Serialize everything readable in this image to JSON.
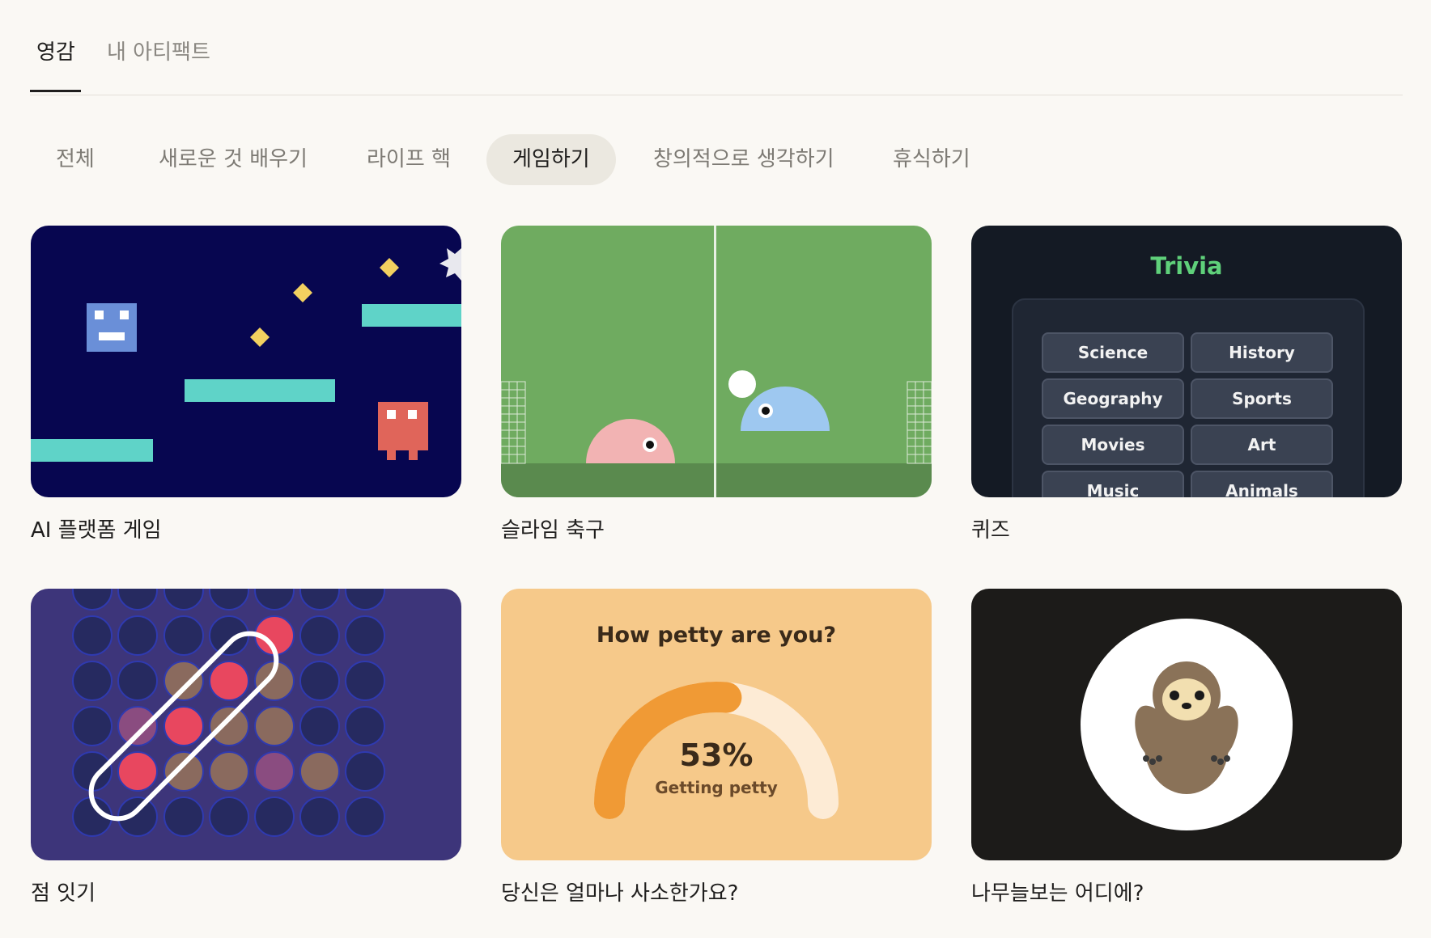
{
  "top_tabs": [
    {
      "label": "영감",
      "active": true
    },
    {
      "label": "내 아티팩트",
      "active": false
    }
  ],
  "categories": [
    {
      "label": "전체",
      "active": false
    },
    {
      "label": "새로운 것 배우기",
      "active": false
    },
    {
      "label": "라이프 핵",
      "active": false
    },
    {
      "label": "게임하기",
      "active": true
    },
    {
      "label": "창의적으로 생각하기",
      "active": false
    },
    {
      "label": "휴식하기",
      "active": false
    }
  ],
  "cards": [
    {
      "title": "AI 플랫폼 게임"
    },
    {
      "title": "슬라임 축구"
    },
    {
      "title": "퀴즈",
      "preview": {
        "heading": "Trivia",
        "topics": [
          "Science",
          "History",
          "Geography",
          "Sports",
          "Movies",
          "Art",
          "Music",
          "Animals"
        ]
      }
    },
    {
      "title": "점 잇기"
    },
    {
      "title": "당신은 얼마나 사소한가요?",
      "preview": {
        "question": "How petty are you?",
        "percent_label": "53%",
        "percent_value": 53,
        "status": "Getting petty"
      }
    },
    {
      "title": "나무늘보는 어디에?"
    }
  ],
  "colors": {
    "background": "#faf8f4",
    "chip_active": "#ebe8e0",
    "platform_bg": "#070650",
    "soccer_bg": "#6fab60",
    "trivia_bg": "#141a24",
    "trivia_heading": "#5fd07a",
    "dots_bg": "#3d357a",
    "petty_bg": "#f6c98a",
    "sloth_bg": "#1c1b19"
  }
}
